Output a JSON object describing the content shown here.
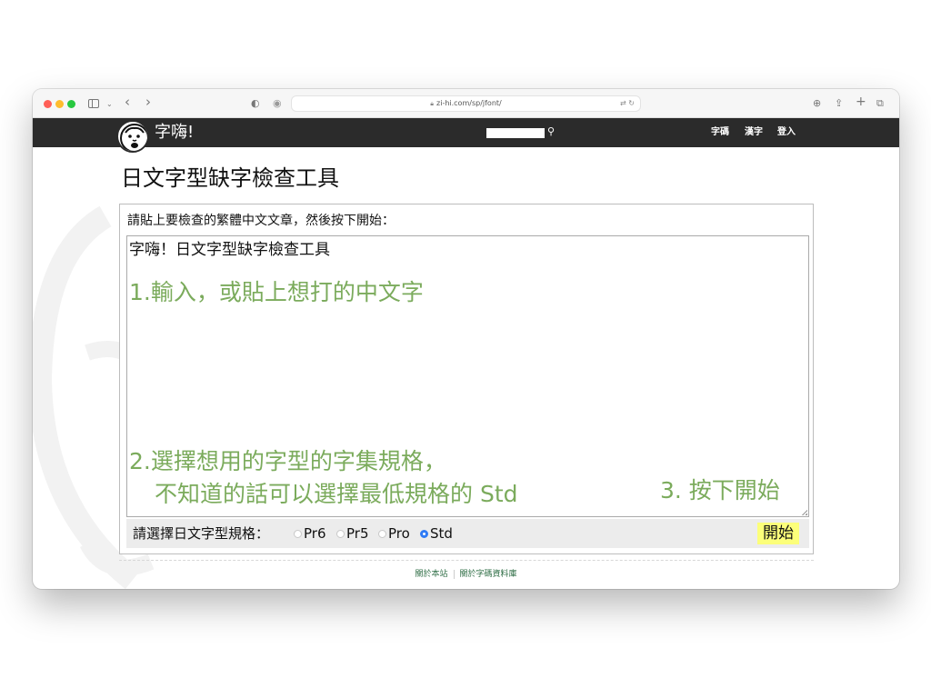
{
  "browser": {
    "url": "zi-hi.com/sp/jfont/"
  },
  "site": {
    "logo_text": "字嗨!",
    "nav": [
      "字碼",
      "漢字",
      "登入"
    ]
  },
  "page": {
    "title": "日文字型缺字檢查工具",
    "form_label": "請貼上要檢查的繁體中文文章，然後按下開始：",
    "textarea_value": "字嗨！日文字型缺字檢查工具",
    "annotations": {
      "step1": "1.輸入，或貼上想打的中文字",
      "step2_line1": "2.選擇想用的字型的字集規格，",
      "step2_line2": "不知道的話可以選擇最低規格的 Std",
      "step3": "3. 按下開始"
    },
    "options_label": "請選擇日文字型規格：",
    "radio_options": [
      {
        "label": "Pr6",
        "checked": false
      },
      {
        "label": "Pr5",
        "checked": false
      },
      {
        "label": "Pro",
        "checked": false
      },
      {
        "label": "Std",
        "checked": true
      }
    ],
    "start_button": "開始"
  },
  "footer": {
    "links": [
      "關於本站",
      "關於字碼資料庫"
    ]
  },
  "colors": {
    "header_bg": "#2b2b2b",
    "annotation": "#7bab5c",
    "button_bg": "#fcff7a",
    "radio_checked": "#2f7bf5"
  }
}
